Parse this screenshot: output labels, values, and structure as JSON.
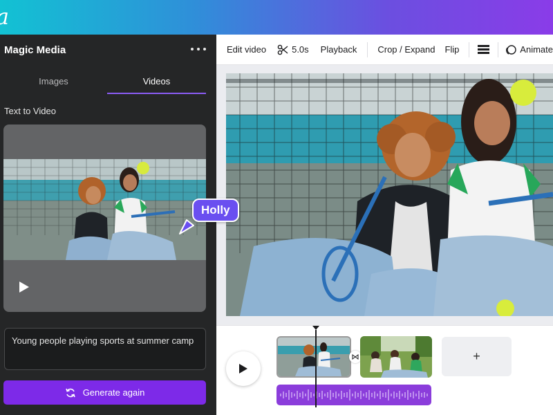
{
  "logo": {
    "glyph": "a"
  },
  "panel": {
    "title": "Magic Media",
    "tabs": [
      {
        "label": "Images",
        "active": false
      },
      {
        "label": "Videos",
        "active": true
      }
    ],
    "section_label": "Text to Video",
    "prompt": "Young people playing sports at summer camp",
    "generate_label": "Generate again"
  },
  "toolbar": {
    "edit_video": "Edit video",
    "duration": "5.0s",
    "playback": "Playback",
    "crop_expand": "Crop / Expand",
    "flip": "Flip",
    "animate": "Animate"
  },
  "timeline": {
    "add_label": "+"
  },
  "collaborator": {
    "name": "Holly"
  },
  "colors": {
    "accent": "#7d2ae8",
    "collaborator": "#6a4ff0",
    "panel_bg": "#252627",
    "audio_track": "#8b3ddb"
  }
}
